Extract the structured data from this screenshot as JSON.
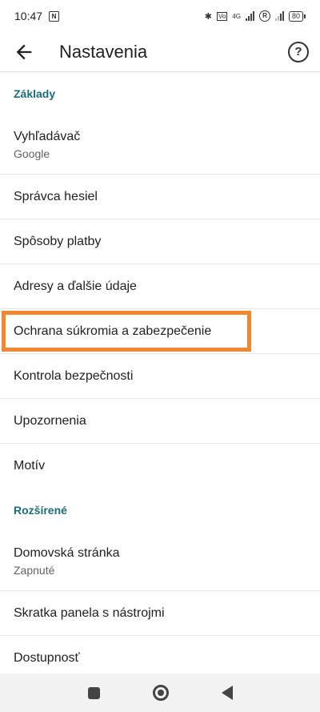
{
  "status_bar": {
    "time": "10:47",
    "nfc": "N",
    "network": "4G",
    "roaming": "R",
    "battery": "80"
  },
  "app_bar": {
    "title": "Nastavenia",
    "back_icon": "arrow-back-icon",
    "help_icon": "help-circle-icon",
    "help_glyph": "?"
  },
  "sections": [
    {
      "header": "Základy",
      "items": [
        {
          "label": "Vyhľadávač",
          "sub": "Google"
        },
        {
          "label": "Správca hesiel"
        },
        {
          "label": "Spôsoby platby"
        },
        {
          "label": "Adresy a ďalšie údaje"
        },
        {
          "label": "Ochrana súkromia a zabezpečenie",
          "highlighted": true
        },
        {
          "label": "Kontrola bezpečnosti"
        },
        {
          "label": "Upozornenia"
        },
        {
          "label": "Motív"
        }
      ]
    },
    {
      "header": "Rozšírené",
      "items": [
        {
          "label": "Domovská stránka",
          "sub": "Zapnuté"
        },
        {
          "label": "Skratka panela s nástrojmi"
        },
        {
          "label": "Dostupnosť"
        }
      ]
    }
  ],
  "colors": {
    "section_header": "#1e6b7a",
    "highlight": "#f2872f"
  }
}
